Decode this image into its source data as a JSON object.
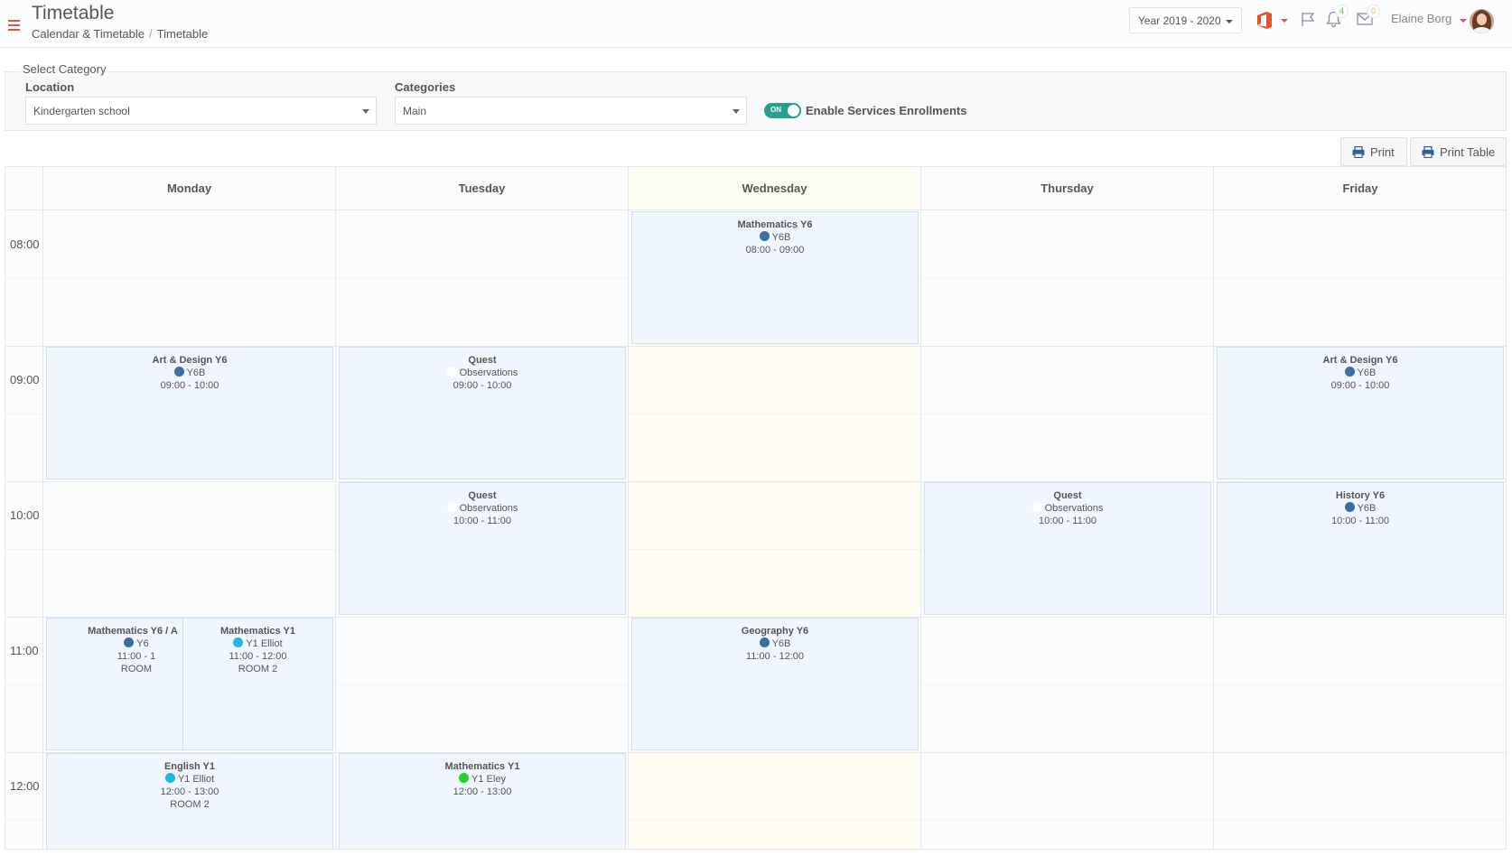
{
  "header": {
    "title": "Timetable",
    "breadcrumb": [
      "Calendar & Timetable",
      "Timetable"
    ],
    "year": "Year 2019 - 2020",
    "notifications_count": "4",
    "messages_count": "0",
    "user_name": "Elaine Borg"
  },
  "filter": {
    "legend": "Select Category",
    "location_label": "Location",
    "location_value": "Kindergarten school",
    "categories_label": "Categories",
    "categories_value": "Main",
    "toggle_on_text": "ON",
    "toggle_label": "Enable Services Enrollments"
  },
  "toolbar": {
    "print_label": "Print",
    "print_table_label": "Print Table"
  },
  "calendar": {
    "days": [
      "Monday",
      "Tuesday",
      "Wednesday",
      "Thursday",
      "Friday"
    ],
    "times": [
      "08:00",
      "09:00",
      "10:00",
      "11:00",
      "12:00"
    ],
    "events": {
      "wed_0800": {
        "title": "Mathematics Y6",
        "group": "Y6B",
        "time": "08:00 - 09:00",
        "dot_color": "#3a6ea5"
      },
      "mon_0900": {
        "title": "Art & Design Y6",
        "group": "Y6B",
        "time": "09:00 - 10:00",
        "dot_color": "#3a6ea5"
      },
      "tue_0900": {
        "title": "Quest",
        "group": "Observations",
        "time": "09:00 - 10:00",
        "dot_color": "#ffffff"
      },
      "fri_0900": {
        "title": "Art & Design Y6",
        "group": "Y6B",
        "time": "09:00 - 10:00",
        "dot_color": "#3a6ea5"
      },
      "tue_1000": {
        "title": "Quest",
        "group": "Observations",
        "time": "10:00 - 11:00",
        "dot_color": "#ffffff"
      },
      "thu_1000": {
        "title": "Quest",
        "group": "Observations",
        "time": "10:00 - 11:00",
        "dot_color": "#ffffff"
      },
      "fri_1000": {
        "title": "History Y6",
        "group": "Y6B",
        "time": "10:00 - 11:00",
        "dot_color": "#3a6ea5"
      },
      "mon_1100a": {
        "title": "Mathematics Y6 / A",
        "group": "Y6",
        "time": "11:00 - 1",
        "room": "ROOM",
        "dot_color": "#3a6ea5"
      },
      "mon_1100b": {
        "title": "Mathematics Y1",
        "group": "Y1 Elliot",
        "time": "11:00 - 12:00",
        "room": "ROOM 2",
        "dot_color": "#1fb6e8"
      },
      "wed_1100": {
        "title": "Geography Y6",
        "group": "Y6B",
        "time": "11:00 - 12:00",
        "dot_color": "#3a6ea5"
      },
      "mon_1200": {
        "title": "English Y1",
        "group": "Y1 Elliot",
        "time": "12:00 - 13:00",
        "room": "ROOM 2",
        "dot_color": "#1fb6e8"
      },
      "tue_1200": {
        "title": "Mathematics Y1",
        "group": "Y1 Eley",
        "time": "12:00 - 13:00",
        "dot_color": "#22d32a"
      }
    }
  }
}
